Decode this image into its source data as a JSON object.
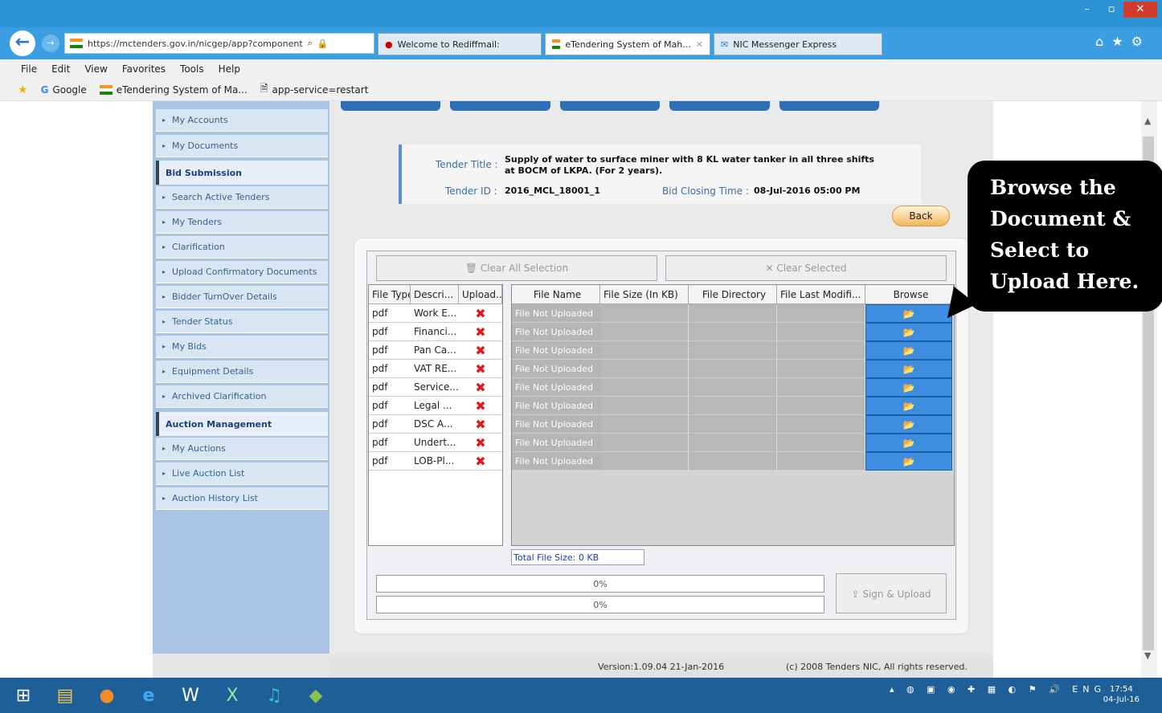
{
  "browser": {
    "address": "https://mctenders.gov.in/nicgep/app?component",
    "tabs": [
      "Welcome to Rediffmail:",
      "eTendering System of Mah...",
      "NIC Messenger Express"
    ],
    "menu": [
      "File",
      "Edit",
      "View",
      "Favorites",
      "Tools",
      "Help"
    ],
    "favorites": [
      "Google",
      "eTendering System of Ma...",
      "app-service=restart"
    ]
  },
  "sidebar": {
    "items_top": [
      "My Accounts",
      "My Documents"
    ],
    "bid_header": "Bid Submission",
    "bid_items": [
      "Search Active Tenders",
      "My Tenders",
      "Clarification",
      "Upload Confirmatory Documents",
      "Bidder TurnOver Details",
      "Tender Status",
      "My Bids",
      "Equipment Details",
      "Archived Clarification"
    ],
    "auction_header": "Auction Management",
    "auction_items": [
      "My Auctions",
      "Live Auction List",
      "Auction History List"
    ]
  },
  "tender": {
    "title_label": "Tender Title :",
    "title_line1": "Supply of water to surface miner with 8 KL water tanker in all three shifts",
    "title_line2": "at BOCM of LKPA. (For 2 years).",
    "id_label": "Tender ID :",
    "id_value": "2016_MCL_18001_1",
    "closing_label": "Bid Closing Time :",
    "closing_value": "08-Jul-2016 05:00 PM",
    "back_label": "Back"
  },
  "upload": {
    "clear_all": "Clear All Selection",
    "clear_selected": "Clear Selected",
    "left_headers": [
      "File Type",
      "Descri...",
      "Upload..."
    ],
    "right_headers": [
      "File Name",
      "File Size (In KB)",
      "File Directory",
      "File Last Modifi...",
      "Browse"
    ],
    "rows": [
      {
        "type": "pdf",
        "desc": "Work E...",
        "status": "File Not Uploaded"
      },
      {
        "type": "pdf",
        "desc": "Financi...",
        "status": "File Not Uploaded"
      },
      {
        "type": "pdf",
        "desc": "Pan Ca...",
        "status": "File Not Uploaded"
      },
      {
        "type": "pdf",
        "desc": "VAT RE...",
        "status": "File Not Uploaded"
      },
      {
        "type": "pdf",
        "desc": "Service...",
        "status": "File Not Uploaded"
      },
      {
        "type": "pdf",
        "desc": "Legal ...",
        "status": "File Not Uploaded"
      },
      {
        "type": "pdf",
        "desc": "DSC A...",
        "status": "File Not Uploaded"
      },
      {
        "type": "pdf",
        "desc": "Undert...",
        "status": "File Not Uploaded"
      },
      {
        "type": "pdf",
        "desc": "LOB-Pl...",
        "status": "File Not Uploaded"
      }
    ],
    "total_size": "Total File Size: 0 KB",
    "progress1": "0%",
    "progress2": "0%",
    "progress_value": 0,
    "sign_upload": "Sign & Upload"
  },
  "footer": {
    "version": "Version:1.09.04 21-Jan-2016",
    "copyright": "(c) 2008 Tenders NIC, All rights reserved."
  },
  "callout": {
    "lines": [
      "Browse the",
      "Document &",
      "Select to",
      "Upload Here."
    ]
  },
  "taskbar": {
    "lang": "ENG",
    "time": "17:54",
    "date": "04-Jul-16"
  },
  "colors": {
    "accent": "#2b93d6",
    "sidebar": "#a9c4e2",
    "not_uploaded": "#e01818",
    "browse_button": "#3d8ee0"
  }
}
